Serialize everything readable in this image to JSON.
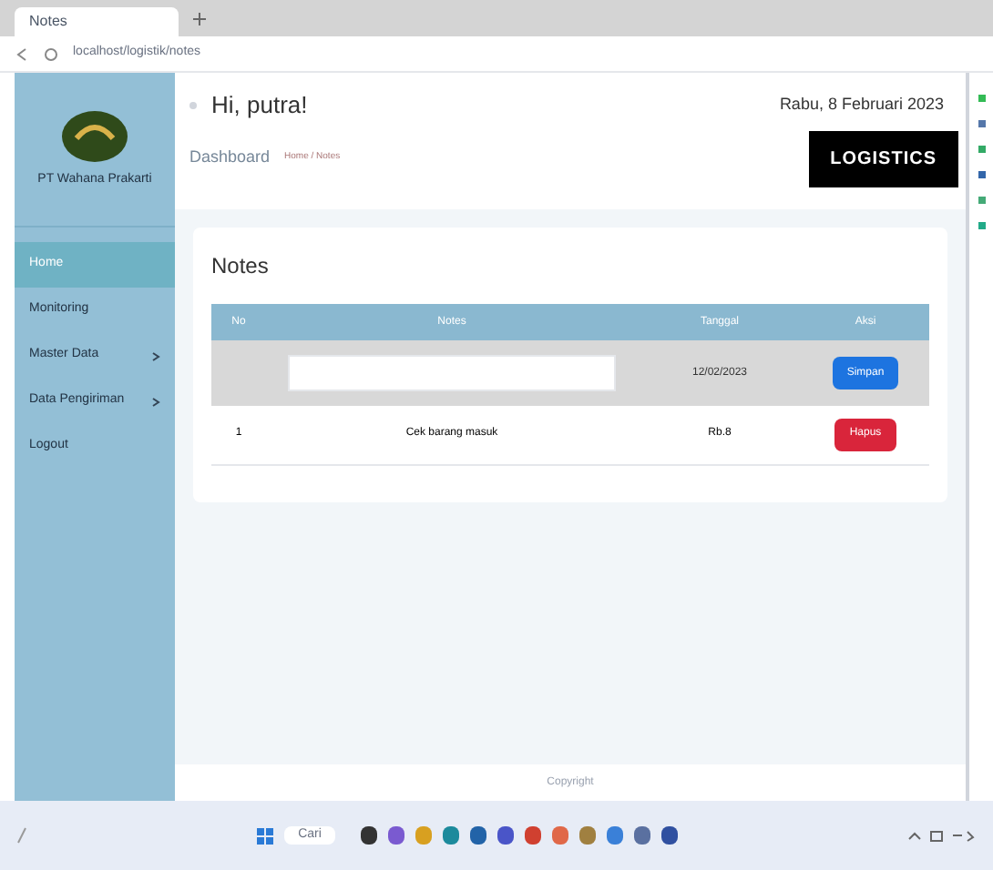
{
  "browser": {
    "tab_title": "Notes",
    "url": "localhost/logistik/notes"
  },
  "sidebar": {
    "company": "PT Wahana Prakarti",
    "items": [
      {
        "label": "Home",
        "selected": true,
        "expandable": false
      },
      {
        "label": "Monitoring",
        "selected": false,
        "expandable": false
      },
      {
        "label": "Master Data",
        "selected": false,
        "expandable": true
      },
      {
        "label": "Data Pengiriman",
        "selected": false,
        "expandable": true
      },
      {
        "label": "Logout",
        "selected": false,
        "expandable": false
      }
    ]
  },
  "header": {
    "greeting": "Hi, putra!",
    "date": "Rabu, 8 Februari 2023",
    "breadcrumb": "Dashboard",
    "breadcrumb_sub": "Home / Notes",
    "logo": "LOGISTICS"
  },
  "notes": {
    "title": "Notes",
    "columns": [
      "No",
      "Notes",
      "Tanggal",
      "Aksi"
    ],
    "input_row": {
      "date": "12/02/2023",
      "button": "Simpan"
    },
    "rows": [
      {
        "no": "1",
        "note": "Cek barang masuk",
        "date": "Rb.8",
        "button": "Hapus"
      }
    ]
  },
  "footer": "Copyright",
  "taskbar": {
    "search": "Cari"
  }
}
